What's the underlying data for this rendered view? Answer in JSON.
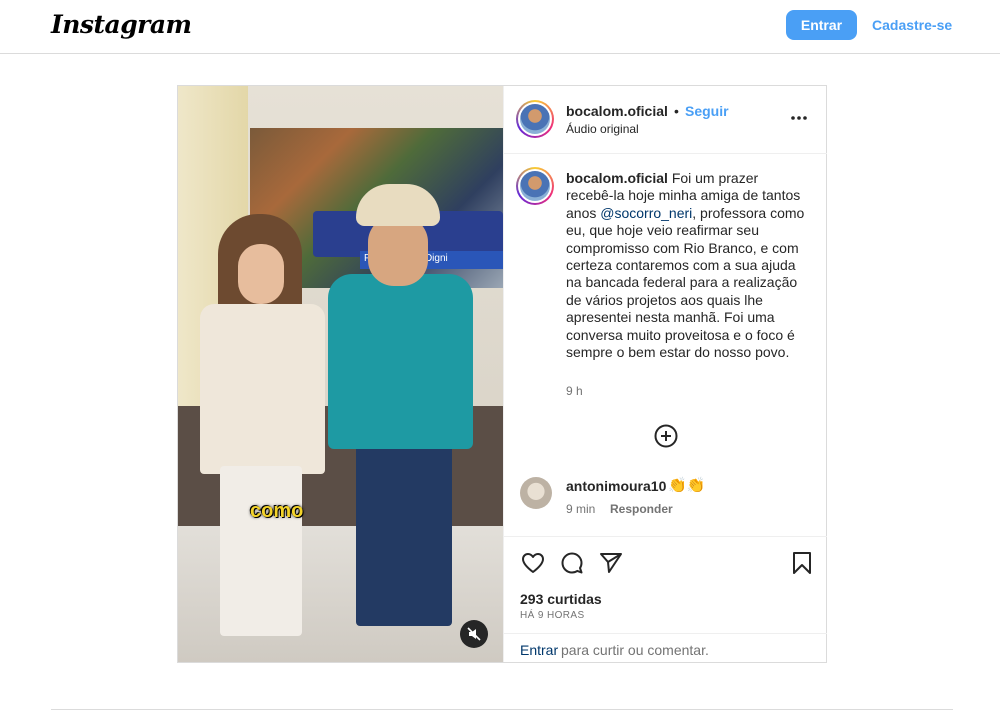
{
  "header": {
    "logo": "Instagram",
    "login_label": "Entrar",
    "signup_label": "Cadastre-se",
    "accent_color": "#4a9ff5"
  },
  "post": {
    "author": "bocalom.oficial",
    "separator": "•",
    "follow_label": "Seguir",
    "audio": "Áudio original",
    "more_icon": "more-horizontal-icon",
    "media_caption_word": "como",
    "media_banner_text": "P Emprego e Digni",
    "caption": {
      "author": "bocalom.oficial",
      "text_before_mention": "Foi um prazer recebê-la hoje minha amiga de tantos anos ",
      "mention": "@socorro_neri",
      "text_after_mention": ", professora como eu, que hoje veio reafirmar seu compromisso com Rio Branco, e com certeza contaremos com a sua ajuda na bancada federal para a realização de vários projetos aos quais lhe apresentei nesta manhã. Foi uma conversa muito proveitosa e o foco é sempre o bem estar do nosso povo.",
      "time": "9 h"
    },
    "comment": {
      "author": "antonimoura10",
      "text": "👏👏",
      "time": "9 min",
      "reply_label": "Responder"
    },
    "likes": "293 curtidas",
    "posted_ago": "HÁ 9 HORAS",
    "login_prompt": {
      "link": "Entrar",
      "rest": "para curtir ou comentar."
    }
  }
}
